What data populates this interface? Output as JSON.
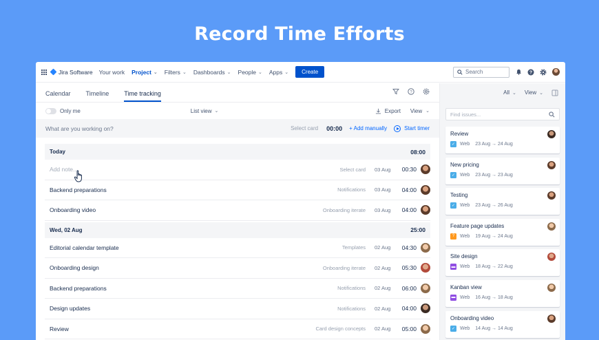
{
  "hero": {
    "title": "Record Time Efforts"
  },
  "topnav": {
    "logo": "Jira Software",
    "items": [
      {
        "label": "Your work",
        "chevron": false,
        "active": false
      },
      {
        "label": "Project",
        "chevron": true,
        "active": true
      },
      {
        "label": "Filters",
        "chevron": true,
        "active": false
      },
      {
        "label": "Dashboards",
        "chevron": true,
        "active": false
      },
      {
        "label": "People",
        "chevron": true,
        "active": false
      },
      {
        "label": "Apps",
        "chevron": true,
        "active": false
      }
    ],
    "create_label": "Create",
    "search_placeholder": "Search"
  },
  "tabs": [
    {
      "label": "Calendar",
      "active": false
    },
    {
      "label": "Timeline",
      "active": false
    },
    {
      "label": "Time tracking",
      "active": true
    }
  ],
  "toolbar": {
    "only_me": "Only me",
    "list_view": "List view",
    "export": "Export",
    "view": "View"
  },
  "entry": {
    "placeholder": "What are you working on?",
    "select_card": "Select card",
    "time": "00:00",
    "add_manually": "+ Add manually",
    "start_timer": "Start timer"
  },
  "groups": [
    {
      "label": "Today",
      "total": "08:00",
      "rows": [
        {
          "desc": "Add note...",
          "placeholder": true,
          "cat": "Select card",
          "date": "03 Aug",
          "dur": "00:30",
          "face": "a"
        },
        {
          "desc": "Backend preparations",
          "placeholder": false,
          "cat": "Notifications",
          "date": "03 Aug",
          "dur": "04:00",
          "face": "a"
        },
        {
          "desc": "Onboarding video",
          "placeholder": false,
          "cat": "Onboarding iterate",
          "date": "03 Aug",
          "dur": "04:00",
          "face": "a"
        }
      ]
    },
    {
      "label": "Wed, 02 Aug",
      "total": "25:00",
      "rows": [
        {
          "desc": "Editorial calendar template",
          "placeholder": false,
          "cat": "Templates",
          "date": "02 Aug",
          "dur": "04:30",
          "face": "b"
        },
        {
          "desc": "Onboarding design",
          "placeholder": false,
          "cat": "Onboarding iterate",
          "date": "02 Aug",
          "dur": "05:30",
          "face": "c"
        },
        {
          "desc": "Backend preparations",
          "placeholder": false,
          "cat": "Notifications",
          "date": "02 Aug",
          "dur": "06:00",
          "face": "b"
        },
        {
          "desc": "Design updates",
          "placeholder": false,
          "cat": "Notifications",
          "date": "02 Aug",
          "dur": "04:00",
          "face": "d"
        },
        {
          "desc": "Review",
          "placeholder": false,
          "cat": "Card design concepts",
          "date": "02 Aug",
          "dur": "05:00",
          "face": "b"
        }
      ]
    }
  ],
  "side": {
    "all": "All",
    "view": "View",
    "find_placeholder": "Find issues...",
    "cards": [
      {
        "title": "Review",
        "type": "task",
        "color": "#4bade8",
        "project": "Web",
        "range": "23 Aug → 24 Aug",
        "face": "d"
      },
      {
        "title": "New pricing",
        "type": "task",
        "color": "#4bade8",
        "project": "Web",
        "range": "23 Aug → 23 Aug",
        "face": "a"
      },
      {
        "title": "Testing",
        "type": "task",
        "color": "#4bade8",
        "project": "Web",
        "range": "23 Aug → 26 Aug",
        "face": "a"
      },
      {
        "title": "Feature page updates",
        "type": "question",
        "color": "#ff991f",
        "project": "Web",
        "range": "19 Aug → 24 Aug",
        "face": "b"
      },
      {
        "title": "Site design",
        "type": "story",
        "color": "#904ee2",
        "project": "Web",
        "range": "18 Aug → 22 Aug",
        "face": "c"
      },
      {
        "title": "Kanban view",
        "type": "story",
        "color": "#904ee2",
        "project": "Web",
        "range": "16 Aug → 18 Aug",
        "face": "b"
      },
      {
        "title": "Onboarding video",
        "type": "task",
        "color": "#4bade8",
        "project": "Web",
        "range": "14 Aug → 14 Aug",
        "face": "a"
      }
    ]
  }
}
